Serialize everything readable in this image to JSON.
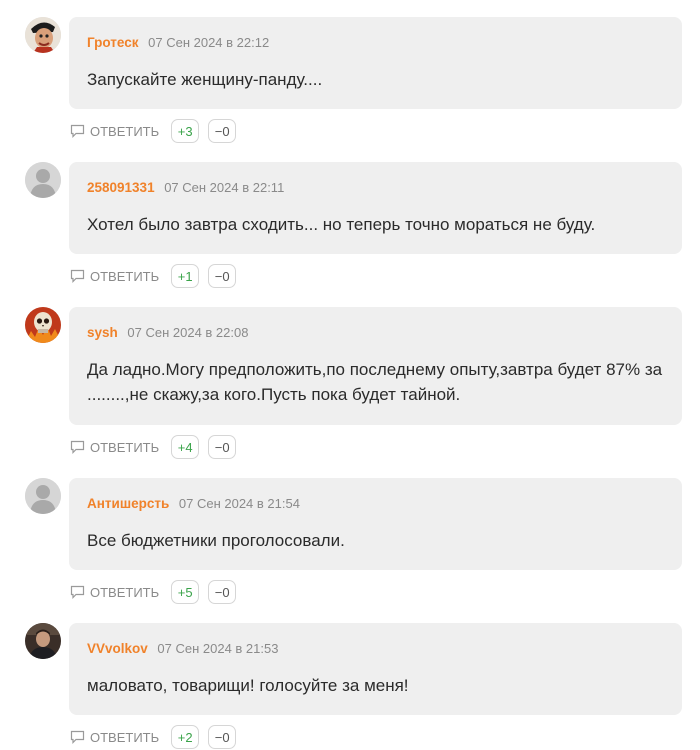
{
  "comments": [
    {
      "author": "Гротеск",
      "date": "07 Сен 2024 в 22:12",
      "text": "Запускайте женщину-панду....",
      "reply_label": "ОТВЕТИТЬ",
      "votes_up": "+3",
      "votes_down": "−0",
      "avatar": "caricature-avatar"
    },
    {
      "author": "258091331",
      "date": "07 Сен 2024 в 22:11",
      "text": "Хотел было завтра сходить... но теперь точно мораться не буду.",
      "reply_label": "ОТВЕТИТЬ",
      "votes_up": "+1",
      "votes_down": "−0",
      "avatar": "default-user-avatar"
    },
    {
      "author": "sysh",
      "date": "07 Сен 2024 в 22:08",
      "text": "Да ладно.Могу предположить,по последнему опыту,завтра будет 87% за ........,не скажу,за кого.Пусть пока будет тайной.",
      "reply_label": "ОТВЕТИТЬ",
      "votes_up": "+4",
      "votes_down": "−0",
      "avatar": "skull-avatar"
    },
    {
      "author": "Антишерсть",
      "date": "07 Сен 2024 в 21:54",
      "text": "Все бюджетники проголосовали.",
      "reply_label": "ОТВЕТИТЬ",
      "votes_up": "+5",
      "votes_down": "−0",
      "avatar": "default-user-avatar"
    },
    {
      "author": "VVvolkov",
      "date": "07 Сен 2024 в 21:53",
      "text": "маловато, товарищи! голосуйте за меня!",
      "reply_label": "ОТВЕТИТЬ",
      "votes_up": "+2",
      "votes_down": "−0",
      "avatar": "photo-avatar"
    }
  ],
  "colors": {
    "author": "#f0822a",
    "bubble": "#efefef",
    "vote_up": "#3aa34a",
    "date": "#8a8a8a"
  }
}
